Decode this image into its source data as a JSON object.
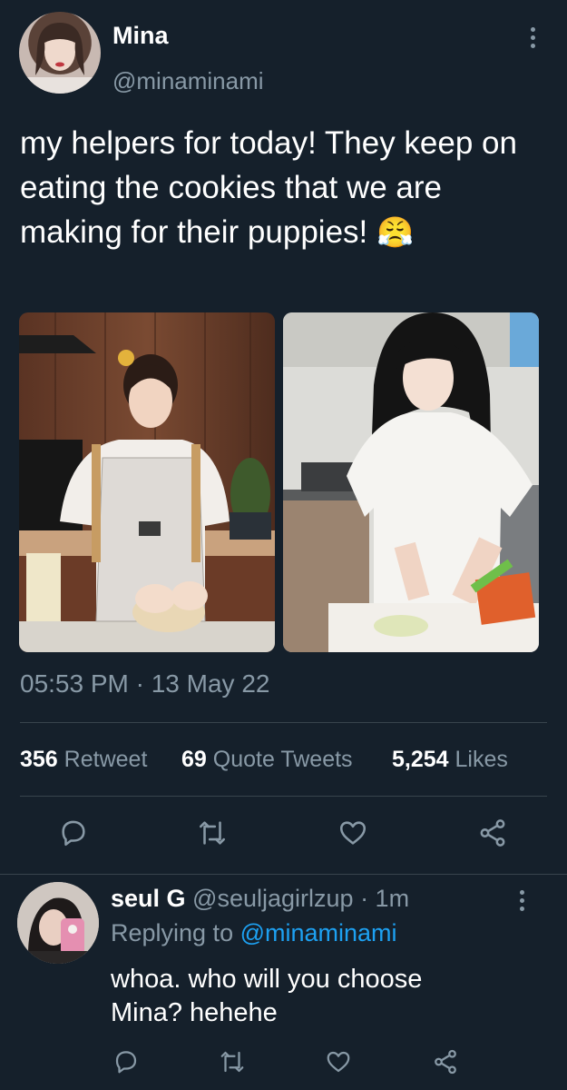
{
  "tweet": {
    "display_name": "Mina",
    "handle": "@minaminami",
    "text": "my helpers for today! They keep on eating the cookies that we are making for their puppies!",
    "emoji": "😤",
    "timestamp": "05:53 PM · 13 May 22",
    "stats": {
      "retweets": "356",
      "retweets_label": "Retweet",
      "quotes": "69",
      "quotes_label": "Quote Tweets",
      "likes": "5,254",
      "likes_label": "Likes"
    }
  },
  "actions": {
    "icons": [
      "reply-icon",
      "retweet-icon",
      "like-icon",
      "share-icon"
    ]
  },
  "reply": {
    "display_name": "seul G",
    "handle": "@seuljagirlzup",
    "time": "· 1m",
    "replying_prefix": "Replying to",
    "replying_handle": "@minaminami",
    "text_line1": "whoa. who will you choose",
    "text_line2": "Mina? hehehe"
  },
  "colors": {
    "background": "#15202b",
    "muted": "#8899a6",
    "link": "#1da1f2",
    "divider": "#38444d"
  }
}
